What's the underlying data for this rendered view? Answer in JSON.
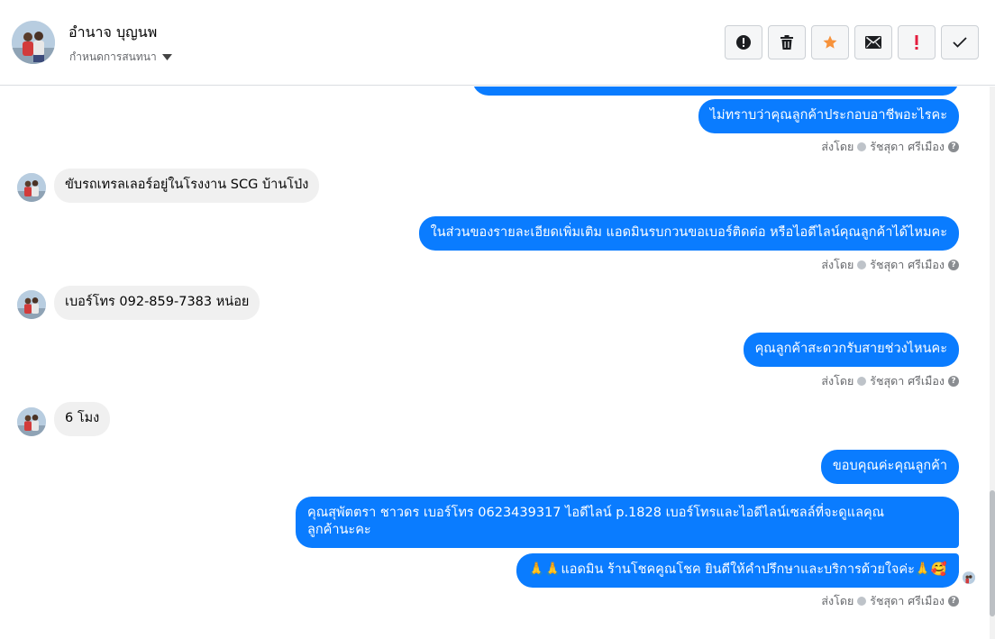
{
  "header": {
    "contact_name": "อำนาจ บุญนพ",
    "assign_label": "กำหนดการสนทนา",
    "caret_icon": "caret-down-icon"
  },
  "actions": [
    {
      "name": "report-spam-button",
      "icon": "exclamation-circle-icon",
      "glyph": "⬤"
    },
    {
      "name": "delete-button",
      "icon": "trash-icon",
      "glyph": "🗑"
    },
    {
      "name": "star-button",
      "icon": "star-icon",
      "glyph": "★"
    },
    {
      "name": "mark-unread-button",
      "icon": "envelope-icon",
      "glyph": "✉"
    },
    {
      "name": "follow-up-button",
      "icon": "exclamation-icon",
      "glyph": "!"
    },
    {
      "name": "mark-done-button",
      "icon": "check-icon",
      "glyph": "✓"
    }
  ],
  "colors": {
    "outgoing_bubble": "#0a7cff",
    "incoming_bubble": "#f0f0f0",
    "star": "#f7923b",
    "follow_up": "#e41e3f"
  },
  "messages": {
    "out_1": "ไม่ทราบว่าคุณลูกค้าประกอบอาชีพอะไรคะ",
    "in_1": "ขับรถเทรลเลอร์อยู่ในโรงงาน SCG บ้านโป่ง",
    "out_2": "ในส่วนของรายละเอียดเพิ่มเติม แอดมินรบกวนขอเบอร์ติดต่อ หรือไอดีไลน์คุณลูกค้าได้ไหมคะ",
    "in_2": "เบอร์โทร 092-859-7383 หน่อย",
    "out_3": "คุณลูกค้าสะดวกรับสายช่วงไหนคะ",
    "in_3": "6 โมง",
    "out_4": "ขอบคุณค่ะคุณลูกค้า",
    "out_5_line1": "คุณสุพัตตรา   ชาวดร      เบอร์โทร 0623439317  ไอดีไลน์ p.1828  เบอร์โทรและไอดีไลน์เซลล์ที่จะดูแลคุณ",
    "out_5_line2": "ลูกค้านะคะ",
    "out_6": "🙏🙏แอดมิน ร้านโชคคูณโชค ยินดีให้คำปรึกษาและบริการด้วยใจค่ะ🙏🥰"
  },
  "sender": {
    "prefix": "ส่งโดย",
    "agent_name": "รัชสุดา ศรีเมือง",
    "help_glyph": "?"
  }
}
